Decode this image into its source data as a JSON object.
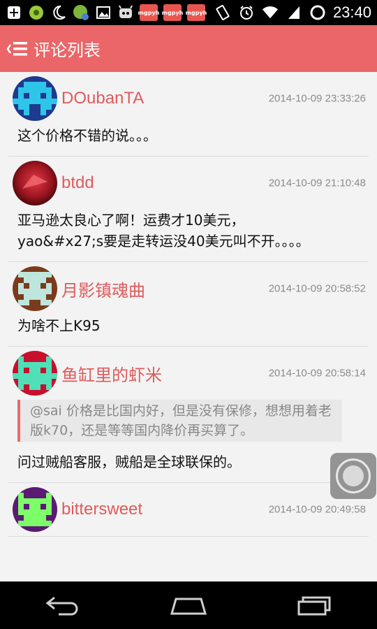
{
  "status_bar": {
    "time": "23:40",
    "left_icons": [
      "add-box-icon",
      "game-icon",
      "moon-icon",
      "app-icon",
      "image-icon",
      "robot-icon",
      "mgpyh-app-icon",
      "mgpyh-app-icon",
      "mgpyh-app-icon"
    ],
    "right_icons": [
      "vibrate-icon",
      "alarm-icon",
      "wifi-icon",
      "signal-icon",
      "battery-ring-icon"
    ],
    "app_badge_label": "mgpyh"
  },
  "action_bar": {
    "title": "评论列表",
    "background": "#ea6668"
  },
  "comments": [
    {
      "username": "DOubanTA",
      "timestamp": "2014-10-09 23:33:26",
      "text": "这个价格不错的说。。。"
    },
    {
      "username": "btdd",
      "timestamp": "2014-10-09 21:10:48",
      "text": "亚马逊太良心了啊！运费才10美元，yao&#x27;s要是走转运没40美元叫不开。。。。"
    },
    {
      "username": "月影镇魂曲",
      "timestamp": "2014-10-09 20:58:52",
      "text": "为啥不上K95"
    },
    {
      "username": "鱼缸里的虾米",
      "timestamp": "2014-10-09 20:58:14",
      "quote": "@sai 价格是比国内好，但是没有保修，想想用着老版k70，还是等等国内降价再买算了。",
      "text": "问过贼船客服，贼船是全球联保的。"
    },
    {
      "username": "bittersweet",
      "timestamp": "2014-10-09 20:49:58",
      "text": ""
    }
  ],
  "colors": {
    "accent": "#ea6668",
    "username": "#e05a5c",
    "timestamp": "#8b8b8b"
  }
}
